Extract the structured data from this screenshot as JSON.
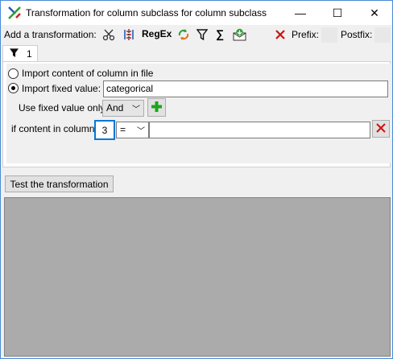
{
  "window": {
    "title": "Transformation for column subclass for column subclass",
    "minimize_glyph": "—",
    "maximize_glyph": "☐",
    "close_glyph": "✕"
  },
  "toolbar": {
    "add_label": "Add a transformation:",
    "regex_label": "RegEx",
    "sigma_label": "∑",
    "prefix_label": "Prefix:",
    "postfix_label": "Postfix:"
  },
  "tabs": [
    {
      "label": "1"
    }
  ],
  "transformation": {
    "option_import_content": "Import content of column in file",
    "option_import_fixed": "Import fixed value:",
    "fixed_value": "categorical",
    "use_fixed_value_label": "Use fixed value only",
    "logic_operator": "And",
    "condition_label": "if content in column",
    "condition_column": "3",
    "condition_operator": "=",
    "condition_value": ""
  },
  "test_button_label": "Test the transformation",
  "colors": {
    "accent_border": "#4a8ad6",
    "focus_blue": "#0078d7",
    "add_green": "#1aa51a",
    "delete_red": "#d01010",
    "preview_gray": "#ababab"
  }
}
